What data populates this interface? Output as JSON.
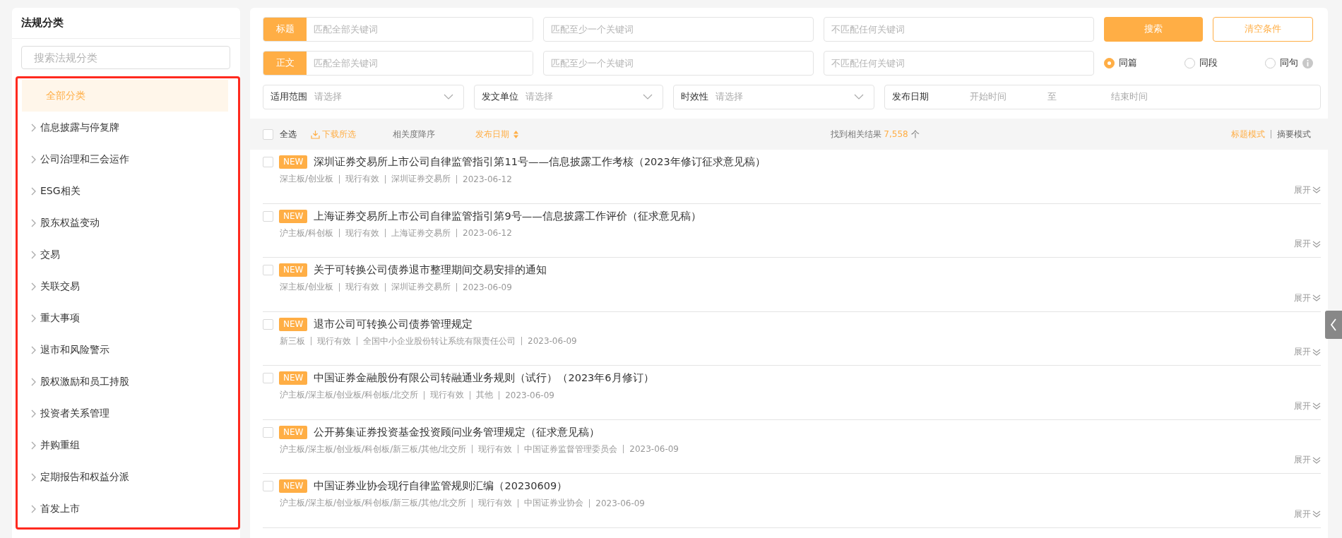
{
  "sidebar": {
    "title": "法规分类",
    "search": {
      "placeholder": "搜索法规分类"
    },
    "items": [
      {
        "label": "全部分类",
        "kind": "all",
        "selected": true
      },
      {
        "label": "信息披露与停复牌",
        "kind": "category",
        "selected": false
      },
      {
        "label": "公司治理和三会运作",
        "kind": "category",
        "selected": false
      },
      {
        "label": "ESG相关",
        "kind": "category",
        "selected": false
      },
      {
        "label": "股东权益变动",
        "kind": "category",
        "selected": false
      },
      {
        "label": "交易",
        "kind": "category",
        "selected": false
      },
      {
        "label": "关联交易",
        "kind": "category",
        "selected": false
      },
      {
        "label": "重大事项",
        "kind": "category",
        "selected": false
      },
      {
        "label": "退市和风险警示",
        "kind": "category",
        "selected": false
      },
      {
        "label": "股权激励和员工持股",
        "kind": "category",
        "selected": false
      },
      {
        "label": "投资者关系管理",
        "kind": "category",
        "selected": false
      },
      {
        "label": "并购重组",
        "kind": "category",
        "selected": false
      },
      {
        "label": "定期报告和权益分派",
        "kind": "category",
        "selected": false
      },
      {
        "label": "首发上市",
        "kind": "category",
        "selected": false
      }
    ]
  },
  "filters": {
    "keyword_rows": [
      {
        "label": "标题",
        "fields": [
          {
            "placeholder": "匹配全部关键词"
          },
          {
            "placeholder": "匹配至少一个关键词"
          },
          {
            "placeholder": "不匹配任何关键词"
          }
        ]
      },
      {
        "label": "正文",
        "fields": [
          {
            "placeholder": "匹配全部关键词"
          },
          {
            "placeholder": "匹配至少一个关键词"
          },
          {
            "placeholder": "不匹配任何关键词"
          }
        ]
      }
    ],
    "search_button": "搜索",
    "clear_button": "清空条件",
    "scope": [
      {
        "label": "同篇",
        "selected": true
      },
      {
        "label": "同段",
        "selected": false
      },
      {
        "label": "同句",
        "selected": false
      }
    ],
    "selects": [
      {
        "label": "适用范围",
        "placeholder": "请选择"
      },
      {
        "label": "发文单位",
        "placeholder": "请选择"
      },
      {
        "label": "时效性",
        "placeholder": "请选择"
      }
    ],
    "date": {
      "label": "发布日期",
      "start_placeholder": "开始时间",
      "separator": "至",
      "end_placeholder": "结束时间"
    }
  },
  "toolbar": {
    "select_all": {
      "label": "全选",
      "checked": false
    },
    "download": "下载所选",
    "sorts": [
      {
        "label": "相关度降序",
        "selected": false
      },
      {
        "label": "发布日期",
        "selected": true
      }
    ],
    "result_prefix": "找到相关结果",
    "result_count": "7,558",
    "result_suffix": "个",
    "modes": [
      {
        "label": "标题模式",
        "selected": true
      },
      {
        "label": "摘要模式",
        "selected": false
      }
    ]
  },
  "results": [
    {
      "checked": false,
      "badge": "NEW",
      "title": "深圳证券交易所上市公司自律监管指引第11号——信息披露工作考核（2023年修订征求意见稿）",
      "meta": [
        "深主板/创业板",
        "现行有效",
        "深圳证券交易所",
        "2023-06-12"
      ],
      "expand": "展开"
    },
    {
      "checked": false,
      "badge": "NEW",
      "title": "上海证券交易所上市公司自律监管指引第9号——信息披露工作评价（征求意见稿）",
      "meta": [
        "沪主板/科创板",
        "现行有效",
        "上海证券交易所",
        "2023-06-12"
      ],
      "expand": "展开"
    },
    {
      "checked": false,
      "badge": "NEW",
      "title": "关于可转换公司债券退市整理期间交易安排的通知",
      "meta": [
        "深主板/创业板",
        "现行有效",
        "深圳证券交易所",
        "2023-06-09"
      ],
      "expand": "展开"
    },
    {
      "checked": false,
      "badge": "NEW",
      "title": "退市公司可转换公司债券管理规定",
      "meta": [
        "新三板",
        "现行有效",
        "全国中小企业股份转让系统有限责任公司",
        "2023-06-09"
      ],
      "expand": "展开"
    },
    {
      "checked": false,
      "badge": "NEW",
      "title": "中国证券金融股份有限公司转融通业务规则（试行）（2023年6月修订）",
      "meta": [
        "沪主板/深主板/创业板/科创板/北交所",
        "现行有效",
        "其他",
        "2023-06-09"
      ],
      "expand": "展开"
    },
    {
      "checked": false,
      "badge": "NEW",
      "title": "公开募集证券投资基金投资顾问业务管理规定（征求意见稿）",
      "meta": [
        "沪主板/深主板/创业板/科创板/新三板/其他/北交所",
        "现行有效",
        "中国证券监督管理委员会",
        "2023-06-09"
      ],
      "expand": "展开"
    },
    {
      "checked": false,
      "badge": "NEW",
      "title": "中国证券业协会现行自律监管规则汇编（20230609）",
      "meta": [
        "沪主板/深主板/创业板/科创板/新三板/其他/北交所",
        "现行有效",
        "中国证券业协会",
        "2023-06-09"
      ],
      "expand": "展开"
    }
  ]
}
